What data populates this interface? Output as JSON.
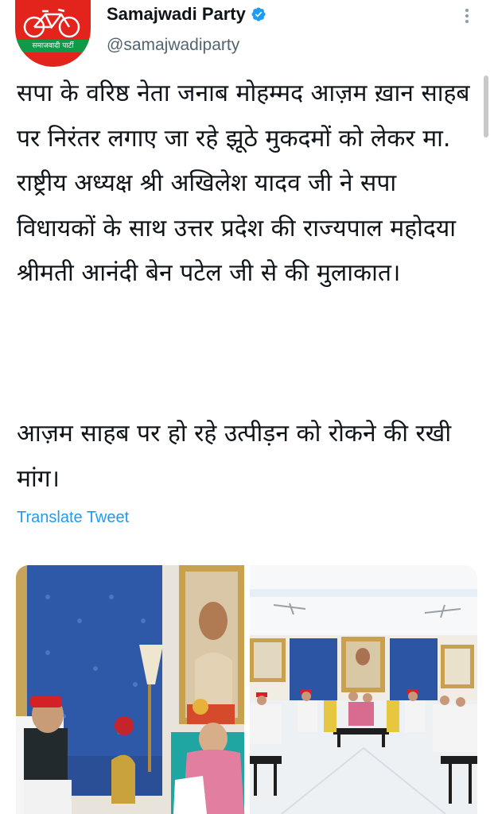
{
  "tweet": {
    "display_name": "Samajwadi Party",
    "handle": "@samajwadiparty",
    "verified": true,
    "avatar_text": "समाजवादी पार्टी",
    "text_paragraph_1": "सपा के वरिष्ठ नेता जनाब मोहम्मद आज़म ख़ान साहब पर निरंतर लगाए जा रहे झूठे मुकदमों को लेकर मा. राष्ट्रीय अध्यक्ष श्री अखिलेश यादव जी ने सपा विधायकों के साथ उत्तर प्रदेश की राज्यपाल महोदया श्रीमती आनंदी बेन पटेल जी से की मुलाकात।",
    "text_paragraph_2": "आज़म साहब पर हो रहे उत्पीड़न को रोकने की रखी मांग।",
    "translate_label": "Translate Tweet"
  },
  "colors": {
    "accent_blue": "#1d9bf0",
    "party_red": "#e2241d",
    "party_green": "#0f9a48"
  },
  "icons": {
    "verified": "verified-badge-icon",
    "more": "more-options-icon"
  },
  "media": {
    "count": 2
  }
}
